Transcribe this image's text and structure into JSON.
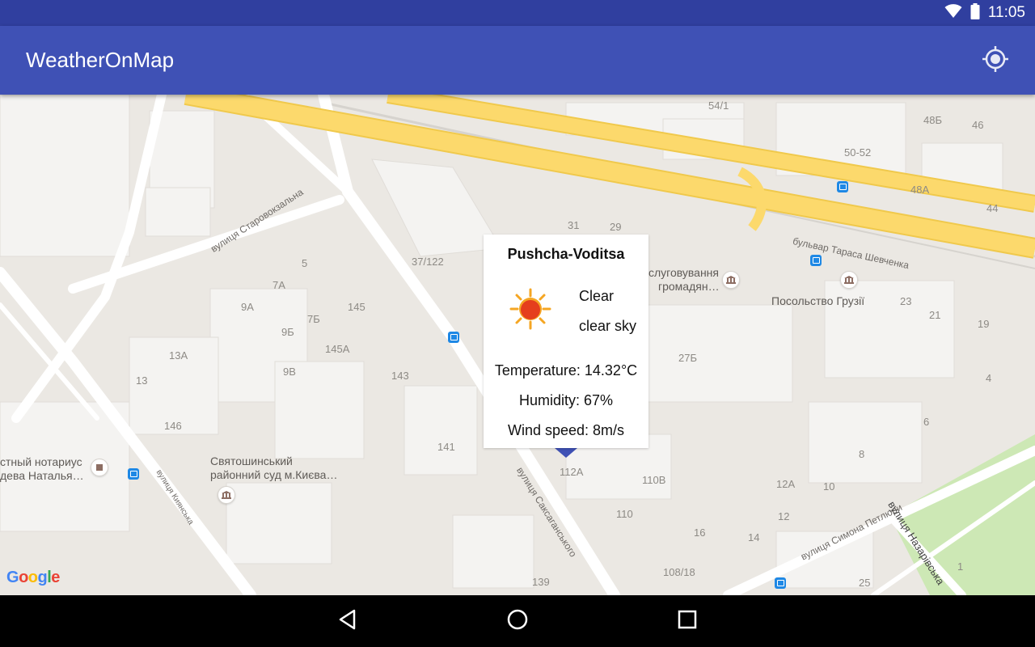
{
  "status_bar": {
    "time": "11:05",
    "icons": [
      "wifi-icon",
      "battery-icon"
    ],
    "background": "#303f9f"
  },
  "app_bar": {
    "title": "WeatherOnMap",
    "background": "#3f51b5",
    "action_icon": "my-location-icon"
  },
  "map": {
    "logo_text": "Google",
    "building_numbers": [
      "54/1",
      "48Б",
      "46",
      "50-52",
      "48А",
      "44",
      "31",
      "29",
      "37/122",
      "5",
      "7А",
      "9А",
      "7Б",
      "145",
      "9Б",
      "145А",
      "13А",
      "9В",
      "143",
      "13",
      "146",
      "141",
      "112А",
      "110В",
      "110",
      "12А",
      "10",
      "12",
      "16",
      "14",
      "108/18",
      "139",
      "25",
      "27Б",
      "23",
      "21",
      "19",
      "4",
      "6",
      "8",
      "1"
    ],
    "street_labels": {
      "starovokzalna": "вулиця Старовокзальна",
      "shevchenka": "бульвар Тараса Шевченка",
      "saksahanskoho": "вулиця Саксаганського",
      "kyianska": "вулиця Киянська",
      "petliury": "вулиця Симона Петлюри",
      "nazarivska": "вулиця Назарівська"
    },
    "poi_labels": {
      "service_line1": "Обслуговування",
      "service_line1_visible": "слуговування",
      "service_line2": "громадян…",
      "embassy": "Посольство Грузії",
      "court_line1": "Святошинський",
      "court_line2": "районний суд м.Києва…",
      "notary_line1": "стный нотариус",
      "notary_line2": "дева Наталья…"
    }
  },
  "info_window": {
    "location": "Pushcha-Voditsa",
    "weather_icon": "sun-icon",
    "main": "Clear",
    "description": "clear sky",
    "temperature": "Temperature: 14.32°C",
    "humidity": "Humidity: 67%",
    "wind": "Wind speed: 8m/s"
  },
  "nav_bar": {
    "buttons": [
      "back-icon",
      "home-icon",
      "recents-icon"
    ]
  },
  "colors": {
    "accent": "#3f51b5",
    "major_road": "#fcd96c",
    "road": "#ffffff",
    "land": "#ebe8e3",
    "building": "#f4f3f1",
    "park": "#cde8b5"
  }
}
